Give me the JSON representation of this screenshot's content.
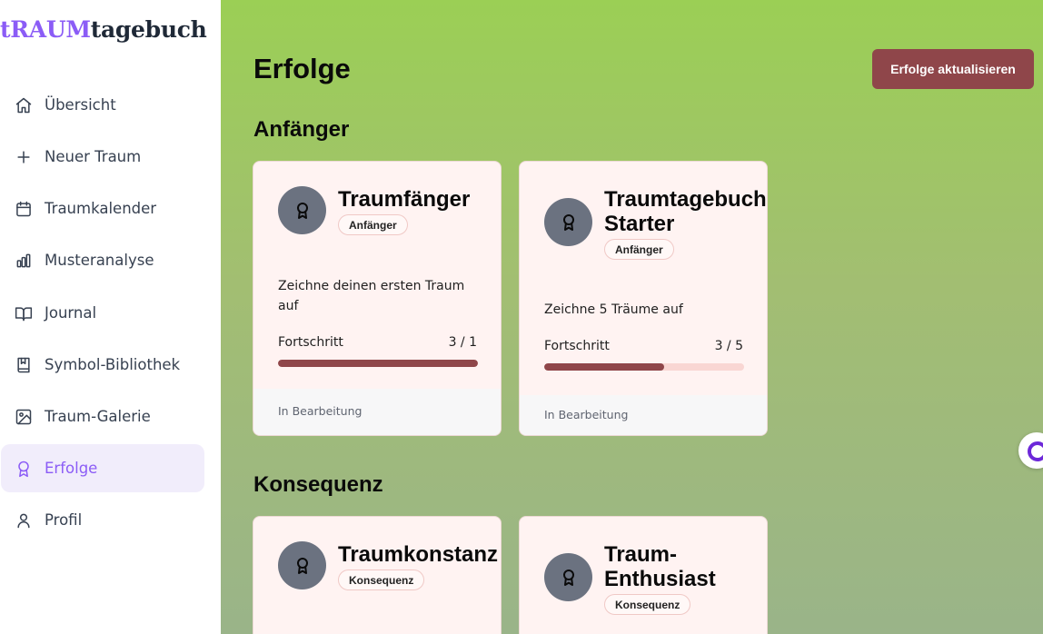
{
  "app": {
    "logo_part1": "tRAUM",
    "logo_part2": "tagebuch"
  },
  "sidebar": {
    "items": [
      {
        "label": "Übersicht",
        "icon": "home-icon"
      },
      {
        "label": "Neuer Traum",
        "icon": "plus-icon"
      },
      {
        "label": "Traumkalender",
        "icon": "calendar-icon"
      },
      {
        "label": "Musteranalyse",
        "icon": "bar-chart-icon"
      },
      {
        "label": "Journal",
        "icon": "book-open-icon"
      },
      {
        "label": "Symbol-Bibliothek",
        "icon": "book-icon"
      },
      {
        "label": "Traum-Galerie",
        "icon": "image-icon"
      },
      {
        "label": "Erfolge",
        "icon": "award-icon",
        "active": true
      },
      {
        "label": "Profil",
        "icon": "user-icon"
      }
    ]
  },
  "main": {
    "title": "Erfolge",
    "refresh_label": "Erfolge aktualisieren",
    "sections": [
      {
        "title": "Anfänger",
        "cards": [
          {
            "title": "Traumfänger",
            "category": "Anfänger",
            "description": "Zeichne deinen ersten Traum auf",
            "progress_label": "Fortschritt",
            "progress_text": "3 / 1",
            "progress_fraction": 1.0,
            "status": "In Bearbeitung"
          },
          {
            "title_line1": "Traumtagebuch",
            "title_line2": "Starter",
            "category": "Anfänger",
            "description": "Zeichne 5 Träume auf",
            "progress_label": "Fortschritt",
            "progress_text": "3 / 5",
            "progress_fraction": 0.6,
            "status": "In Bearbeitung"
          }
        ]
      },
      {
        "title": "Konsequenz",
        "cards": [
          {
            "title": "Traumkonstanz",
            "category": "Konsequenz"
          },
          {
            "title_line1": "Traum-",
            "title_line2": "Enthusiast",
            "category": "Konsequenz"
          }
        ]
      }
    ]
  },
  "colors": {
    "accent": "#8b5cf6",
    "button": "#8f464a",
    "progress_fill": "#8f464a",
    "progress_track": "#f9d6d3",
    "card_bg": "#fff3f2"
  }
}
